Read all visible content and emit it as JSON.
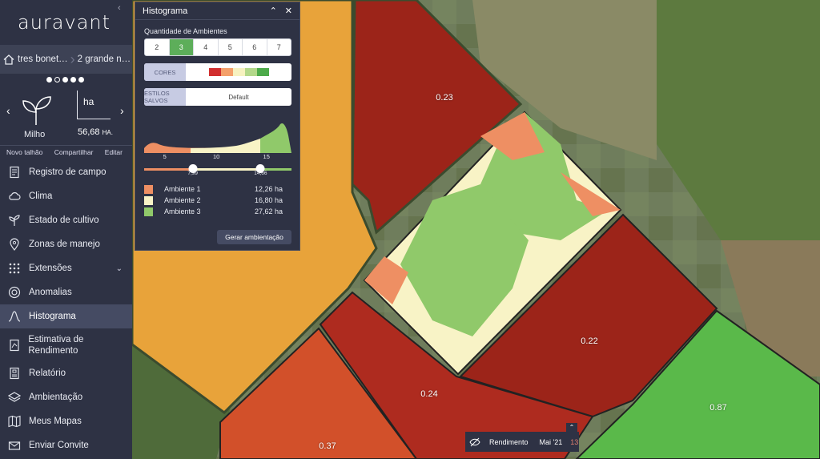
{
  "app": {
    "logo": "auravant"
  },
  "breadcrumb": {
    "items": [
      "tres bonet…",
      "2 grande n…"
    ]
  },
  "field": {
    "crop": "Milho",
    "area_unit_box": "ha",
    "area_value": "56,68",
    "area_unit": "HA."
  },
  "pager": {
    "count": 5,
    "active_index": 1
  },
  "actions": {
    "new_field": "Novo talhão",
    "share": "Compartilhar",
    "edit": "Editar"
  },
  "menu": [
    {
      "label": "Registro de campo",
      "icon": "notebook-icon",
      "active": false
    },
    {
      "label": "Clima",
      "icon": "cloud-icon",
      "active": false
    },
    {
      "label": "Estado de cultivo",
      "icon": "plant-icon",
      "active": false
    },
    {
      "label": "Zonas de manejo",
      "icon": "location-pin-icon",
      "active": false
    },
    {
      "label": "Extensões",
      "icon": "extensions-grid-icon",
      "active": false,
      "expandable": true
    },
    {
      "label": "Anomalias",
      "icon": "anomaly-icon",
      "active": false
    },
    {
      "label": "Histograma",
      "icon": "histogram-icon",
      "active": true
    },
    {
      "label": "Estimativa de Rendimento",
      "icon": "yield-estimate-icon",
      "active": false,
      "tall": true
    },
    {
      "label": "Relatório",
      "icon": "report-icon",
      "active": false
    },
    {
      "label": "Ambientação",
      "icon": "layers-icon",
      "active": false
    },
    {
      "label": "Meus Mapas",
      "icon": "map-icon",
      "active": false
    },
    {
      "label": "Enviar Convite",
      "icon": "envelope-icon",
      "active": false
    }
  ],
  "panel": {
    "title": "Histograma",
    "env_count_label": "Quantidade de Ambientes",
    "env_options": [
      "2",
      "3",
      "4",
      "5",
      "6",
      "7"
    ],
    "env_selected": "3",
    "colors_label": "CORES",
    "color_swatches": [
      "#d12f2f",
      "#f4a06a",
      "#f7f2c0",
      "#b3d88a",
      "#4daa4a"
    ],
    "styles_label": "ESTILOS SALVOS",
    "styles_value": "Default",
    "hist_ticks": [
      "5",
      "10",
      "15"
    ],
    "slider_values": [
      "7,99",
      "14,66"
    ],
    "environments": [
      {
        "name": "Ambiente 1",
        "area": "12,26 ha",
        "color": "#ee8f63"
      },
      {
        "name": "Ambiente 2",
        "area": "16,80 ha",
        "color": "#f8f3c6"
      },
      {
        "name": "Ambiente 3",
        "area": "27,62 ha",
        "color": "#90c96a"
      }
    ],
    "generate_button": "Gerar ambientação"
  },
  "map": {
    "field_labels": [
      "0.23",
      "0.22",
      "0.24",
      "0.37",
      "0.87"
    ],
    "colors": {
      "orange": "#e8a33a",
      "dark_red": "#9c2419",
      "red": "#c03c25",
      "orange_red": "#d2502a",
      "green": "#5ab94a"
    }
  },
  "bottombar": {
    "layer": "Rendimento",
    "date": "Mai '21",
    "count": "13"
  }
}
